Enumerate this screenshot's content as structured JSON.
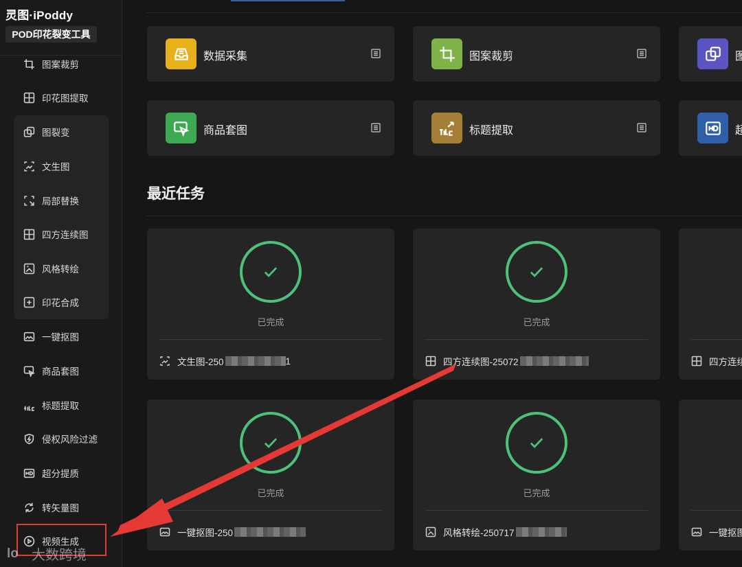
{
  "sidebar": {
    "brand": "灵图·iPoddy",
    "subtitle": "POD印花裂变工具",
    "items": [
      {
        "label": "图案裁剪",
        "icon": "crop-icon"
      },
      {
        "label": "印花图提取",
        "icon": "extract-icon"
      },
      {
        "label": "图裂变",
        "icon": "fission-icon"
      },
      {
        "label": "文生图",
        "icon": "text-to-image-icon"
      },
      {
        "label": "局部替换",
        "icon": "partial-replace-icon"
      },
      {
        "label": "四方连续图",
        "icon": "seamless-pattern-icon"
      },
      {
        "label": "风格转绘",
        "icon": "style-transfer-icon"
      },
      {
        "label": "印花合成",
        "icon": "print-compose-icon"
      },
      {
        "label": "一键抠图",
        "icon": "cutout-icon"
      },
      {
        "label": "商品套图",
        "icon": "product-mockup-icon"
      },
      {
        "label": "标题提取",
        "icon": "title-icon"
      },
      {
        "label": "侵权风险过滤",
        "icon": "shield-icon"
      },
      {
        "label": "超分提质",
        "icon": "hd-icon"
      },
      {
        "label": "转矢量图",
        "icon": "vector-icon"
      },
      {
        "label": "视频生成",
        "icon": "video-icon"
      }
    ]
  },
  "tools": [
    {
      "label": "数据采集",
      "color": "#E8B01A"
    },
    {
      "label": "图案裁剪",
      "color": "#7FB248"
    },
    {
      "label": "图",
      "color": "#5B55C4"
    },
    {
      "label": "商品套图",
      "color": "#3EA953"
    },
    {
      "label": "标题提取",
      "color": "#A67F37"
    },
    {
      "label": "超",
      "color": "#2F5FA8"
    }
  ],
  "recent": {
    "title": "最近任务",
    "status_done": "已完成",
    "tasks": [
      {
        "name": "文生图-250",
        "tail": "1",
        "icon": "text-to-image-icon"
      },
      {
        "name": "四方连续图-25072",
        "tail": "",
        "icon": "seamless-pattern-icon"
      },
      {
        "name": "四方连续",
        "tail": "",
        "icon": "seamless-pattern-icon"
      },
      {
        "name": "一键抠图-250",
        "tail": "",
        "icon": "cutout-icon"
      },
      {
        "name": "风格转绘-250717",
        "tail": "",
        "icon": "style-transfer-icon"
      },
      {
        "name": "一键抠图",
        "tail": "",
        "icon": "cutout-icon"
      }
    ]
  },
  "watermark": {
    "logo": "lo",
    "text": "大数跨境"
  },
  "colors": {
    "accent_green": "#4DC07A",
    "annotation_red": "#E53935",
    "background": "#161616",
    "card": "#252525"
  }
}
